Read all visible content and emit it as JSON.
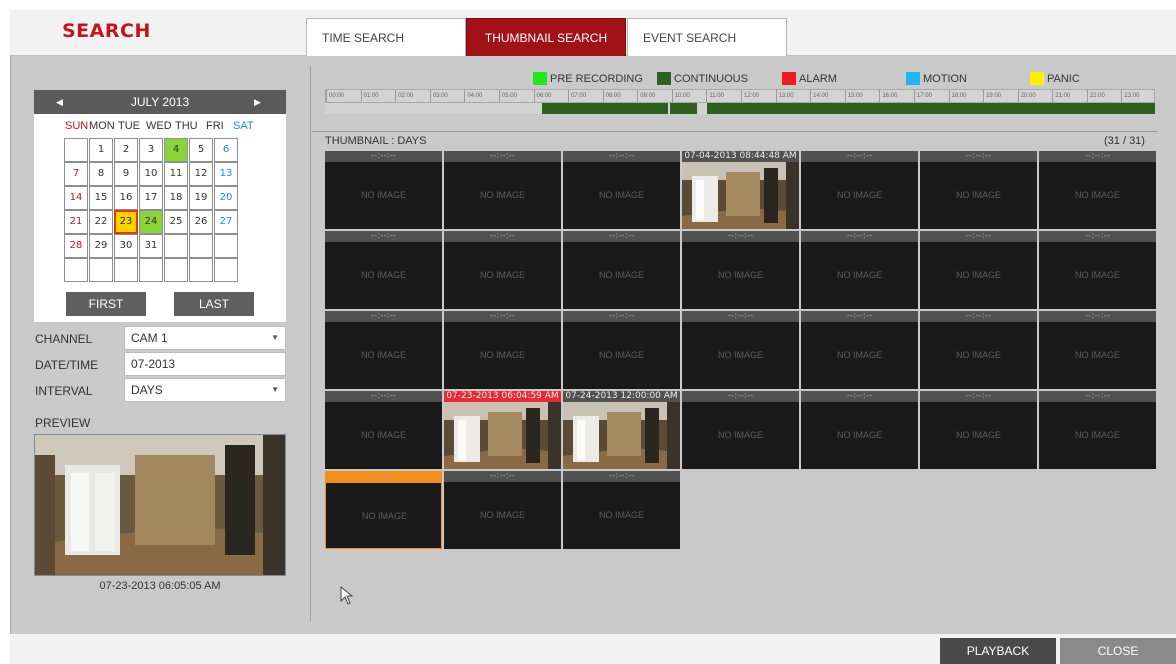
{
  "header": {
    "title": "SEARCH"
  },
  "tabs": [
    {
      "label": "TIME SEARCH"
    },
    {
      "label": "THUMBNAIL SEARCH"
    },
    {
      "label": "EVENT SEARCH"
    }
  ],
  "calendar": {
    "month_label": "JULY 2013",
    "weekdays": [
      "SUN",
      "MON",
      "TUE",
      "WED",
      "THU",
      "FRI",
      "SAT"
    ],
    "days": [
      "1",
      "2",
      "3",
      "4",
      "5",
      "6",
      "7",
      "8",
      "9",
      "10",
      "11",
      "12",
      "13",
      "14",
      "15",
      "16",
      "17",
      "18",
      "19",
      "20",
      "21",
      "22",
      "23",
      "24",
      "25",
      "26",
      "27",
      "28",
      "29",
      "30",
      "31"
    ],
    "first_label": "FIRST",
    "last_label": "LAST"
  },
  "form": {
    "channel_label": "CHANNEL",
    "channel_value": "CAM 1",
    "datetime_label": "DATE/TIME",
    "datetime_value": "07-2013",
    "interval_label": "INTERVAL",
    "interval_value": "DAYS"
  },
  "preview": {
    "label": "PREVIEW",
    "timestamp": "07-23-2013  06:05:05 AM"
  },
  "legend": [
    {
      "label": "PRE RECORDING",
      "color": "#22e61e"
    },
    {
      "label": "CONTINUOUS",
      "color": "#2e5e20"
    },
    {
      "label": "ALARM",
      "color": "#ee1b24"
    },
    {
      "label": "MOTION",
      "color": "#1fb5ef"
    },
    {
      "label": "PANIC",
      "color": "#fff200"
    }
  ],
  "timeline": {
    "hours": [
      "00:00",
      "01:00",
      "02:00",
      "03:00",
      "04:00",
      "05:00",
      "06:00",
      "07:00",
      "08:00",
      "09:00",
      "10:00",
      "11:00",
      "12:00",
      "13:00",
      "14:00",
      "15:00",
      "16:00",
      "17:00",
      "18:00",
      "19:00",
      "20:00",
      "21:00",
      "22:00",
      "23:00"
    ]
  },
  "thumbnails": {
    "label": "THUMBNAIL : DAYS",
    "count": "(31 / 31)",
    "empty_header": "--:--:--",
    "no_image": "NO IMAGE",
    "dated": {
      "d4": "07-04-2013  08:44:48 AM",
      "d23": "07-23-2013  06:04:59 AM",
      "d24": "07-24-2013  12:00:00 AM"
    }
  },
  "buttons": {
    "playback": "PLAYBACK",
    "close": "CLOSE"
  },
  "colors": {
    "brand_red": "#c0151b",
    "tab_active": "#a01218",
    "rec_green": "#8bd23b",
    "selected_yellow": "#ffd200",
    "cursor_orange": "#f3901d"
  }
}
